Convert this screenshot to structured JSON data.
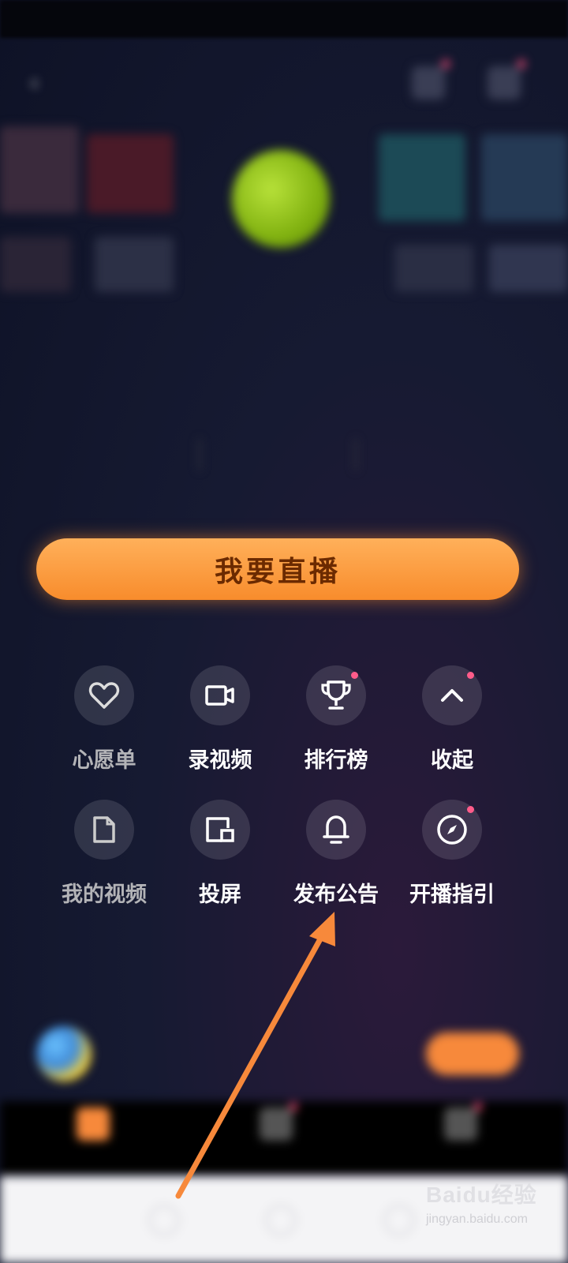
{
  "status_bar": {
    "left": "",
    "right": ""
  },
  "top_nav": {
    "room_title": ""
  },
  "profile": {
    "username": "",
    "subinfo": ""
  },
  "stats": [
    {
      "num": "",
      "label": ""
    },
    {
      "num": "",
      "label": ""
    },
    {
      "num": "",
      "label": ""
    }
  ],
  "live_button": {
    "label": "我要直播"
  },
  "menu": [
    {
      "label": "心愿单",
      "icon": "heart-icon",
      "faded": true,
      "badge": false
    },
    {
      "label": "录视频",
      "icon": "video-record-icon",
      "faded": false,
      "badge": false
    },
    {
      "label": "排行榜",
      "icon": "trophy-icon",
      "faded": false,
      "badge": true
    },
    {
      "label": "收起",
      "icon": "chevron-up-icon",
      "faded": false,
      "badge": true
    },
    {
      "label": "我的视频",
      "icon": "document-icon",
      "faded": true,
      "badge": false
    },
    {
      "label": "投屏",
      "icon": "cast-screen-icon",
      "faded": false,
      "badge": false
    },
    {
      "label": "发布公告",
      "icon": "bell-icon",
      "faded": false,
      "badge": false
    },
    {
      "label": "开播指引",
      "icon": "compass-icon",
      "faded": false,
      "badge": true
    }
  ],
  "promo": {
    "title": "",
    "subtitle": "",
    "button_label": ""
  },
  "tabs": [
    {
      "label": "",
      "active": true
    },
    {
      "label": "",
      "active": false
    },
    {
      "label": "",
      "active": false
    }
  ],
  "watermark": {
    "brand": "Baidu经验",
    "url": "jingyan.baidu.com"
  },
  "colors": {
    "accent": "#f7893b",
    "badge": "#ff5c8a",
    "background": "#161a32"
  }
}
